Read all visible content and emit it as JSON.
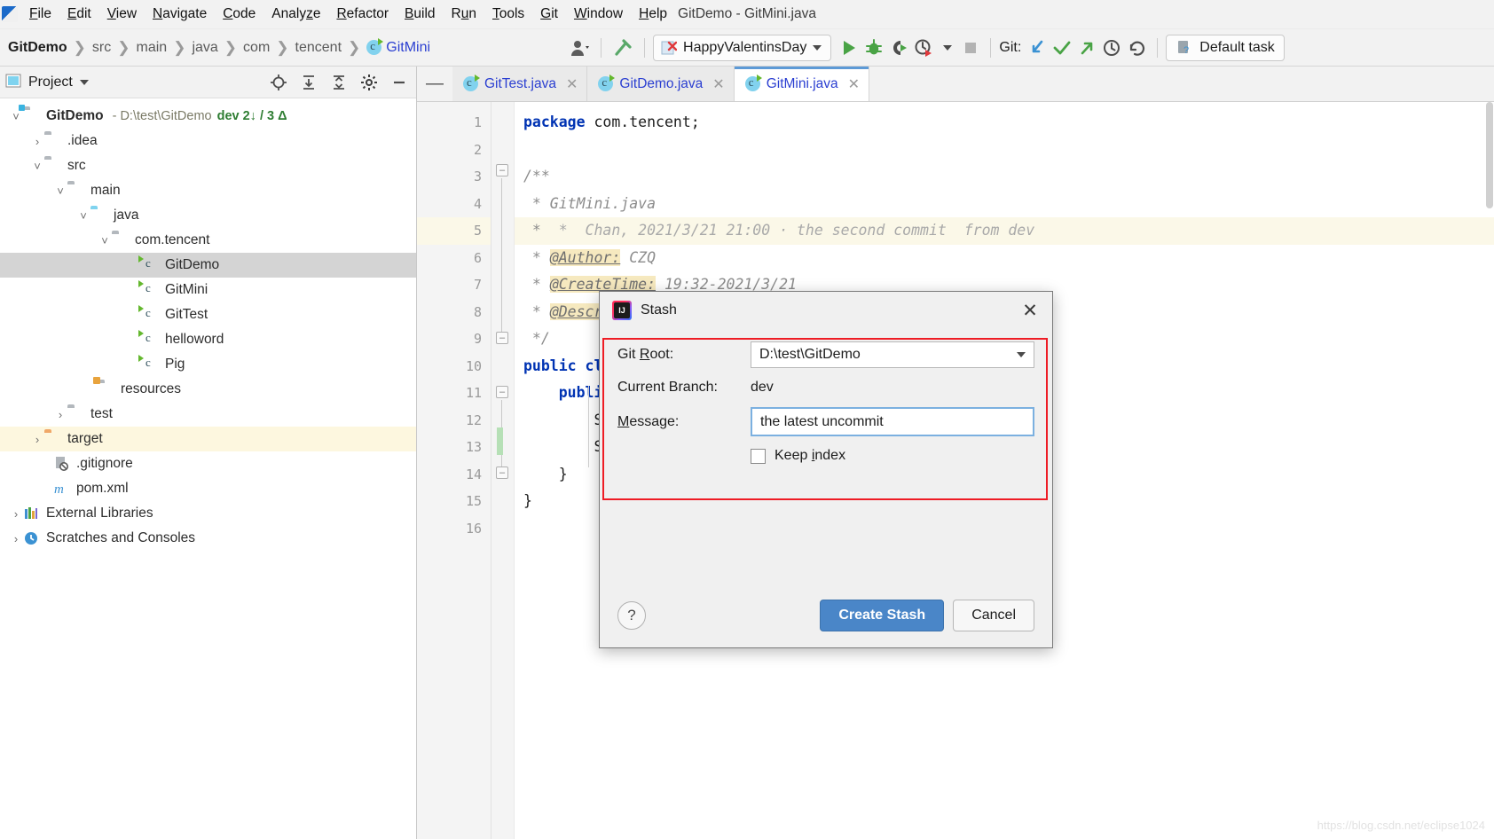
{
  "window": {
    "title": "GitDemo - GitMini.java"
  },
  "menubar": {
    "items": [
      {
        "label": "File",
        "mnemonic": "F"
      },
      {
        "label": "Edit",
        "mnemonic": "E"
      },
      {
        "label": "View",
        "mnemonic": "V"
      },
      {
        "label": "Navigate",
        "mnemonic": "N"
      },
      {
        "label": "Code",
        "mnemonic": "C"
      },
      {
        "label": "Analyze",
        "mnemonic": "z"
      },
      {
        "label": "Refactor",
        "mnemonic": "R"
      },
      {
        "label": "Build",
        "mnemonic": "B"
      },
      {
        "label": "Run",
        "mnemonic": "u"
      },
      {
        "label": "Tools",
        "mnemonic": "T"
      },
      {
        "label": "Git",
        "mnemonic": "G"
      },
      {
        "label": "Window",
        "mnemonic": "W"
      },
      {
        "label": "Help",
        "mnemonic": "H"
      }
    ]
  },
  "toolbar": {
    "breadcrumbs": [
      "GitDemo",
      "src",
      "main",
      "java",
      "com",
      "tencent",
      "GitMini"
    ],
    "run_config": "HappyValentinsDay",
    "git_label": "Git:",
    "default_task": "Default task",
    "icons": {
      "avatar": "user-icon",
      "build": "hammer-icon",
      "run": "run-icon",
      "debug": "debug-icon",
      "run_coverage": "run-with-coverage-icon",
      "profile": "profiler-icon",
      "stop": "stop-icon",
      "update": "git-update-icon",
      "commit": "git-commit-icon",
      "push": "git-push-icon",
      "history": "history-icon",
      "rollback": "rollback-icon",
      "task": "task-icon"
    }
  },
  "project_panel": {
    "title": "Project",
    "icons": [
      "locate-icon",
      "expand-all-icon",
      "collapse-all-icon",
      "settings-gear-icon",
      "hide-icon"
    ],
    "tree": [
      {
        "label": "GitDemo",
        "meta_path": "- D:\\test\\GitDemo",
        "meta_branch": "dev 2↓ / 3 Δ",
        "depth": 0,
        "arrow": "down",
        "icon": "module-folder",
        "color": "blue-bold",
        "state": "normal"
      },
      {
        "label": ".idea",
        "depth": 1,
        "arrow": "right",
        "icon": "folder",
        "color": "gray",
        "state": "normal"
      },
      {
        "label": "src",
        "depth": 1,
        "arrow": "down",
        "icon": "folder",
        "color": "gray",
        "state": "normal"
      },
      {
        "label": "main",
        "depth": 2,
        "arrow": "down",
        "icon": "folder",
        "color": "gray",
        "state": "normal"
      },
      {
        "label": "java",
        "depth": 3,
        "arrow": "down",
        "icon": "source-folder",
        "color": "gray",
        "state": "normal"
      },
      {
        "label": "com.tencent",
        "depth": 4,
        "arrow": "down",
        "icon": "package",
        "color": "blue",
        "state": "normal"
      },
      {
        "label": "GitDemo",
        "depth": 5,
        "arrow": "none",
        "icon": "java-class",
        "color": "blue",
        "state": "selected"
      },
      {
        "label": "GitMini",
        "depth": 5,
        "arrow": "none",
        "icon": "java-class",
        "color": "blue",
        "state": "normal"
      },
      {
        "label": "GitTest",
        "depth": 5,
        "arrow": "none",
        "icon": "java-class",
        "color": "blue",
        "state": "normal"
      },
      {
        "label": "helloword",
        "depth": 5,
        "arrow": "none",
        "icon": "java-class",
        "color": "black",
        "state": "normal"
      },
      {
        "label": "Pig",
        "depth": 5,
        "arrow": "none",
        "icon": "java-class",
        "color": "orange",
        "state": "normal"
      },
      {
        "label": "resources",
        "depth": 4,
        "arrow": "none",
        "icon": "resource-folder",
        "color": "gray",
        "state": "normal"
      },
      {
        "label": "test",
        "depth": 3,
        "arrow": "right",
        "icon": "folder",
        "color": "gray",
        "state": "normal"
      },
      {
        "label": "target",
        "depth": 1,
        "arrow": "right",
        "icon": "excluded-folder",
        "color": "black",
        "state": "highlighted"
      },
      {
        "label": ".gitignore",
        "depth": 2,
        "arrow": "none",
        "icon": "gitignore-file",
        "color": "black",
        "state": "normal"
      },
      {
        "label": "pom.xml",
        "depth": 2,
        "arrow": "none",
        "icon": "maven-file",
        "color": "black",
        "state": "normal"
      },
      {
        "label": "External Libraries",
        "depth": 0,
        "arrow": "right",
        "icon": "libraries-icon",
        "color": "black",
        "state": "normal"
      },
      {
        "label": "Scratches and Consoles",
        "depth": 0,
        "arrow": "right",
        "icon": "scratches-icon",
        "color": "black",
        "state": "normal"
      }
    ]
  },
  "editor": {
    "tabs": [
      {
        "label": "GitTest.java",
        "active": false
      },
      {
        "label": "GitDemo.java",
        "active": false
      },
      {
        "label": "GitMini.java",
        "active": true
      }
    ],
    "line_numbers": [
      "1",
      "2",
      "3",
      "4",
      "5",
      "6",
      "7",
      "8",
      "9",
      "10",
      "11",
      "12",
      "13",
      "14",
      "15",
      "16"
    ],
    "lines": [
      {
        "n": "1",
        "text": "package com.tencent;"
      },
      {
        "n": "2",
        "text": ""
      },
      {
        "n": "3",
        "text": "/**"
      },
      {
        "n": "4",
        "text": " * GitMini.java"
      },
      {
        "n": "5",
        "text": " *  Chan, 2021/3/21 21:00 · the second commit  from dev"
      },
      {
        "n": "6",
        "text": " * @Author: CZQ"
      },
      {
        "n": "7",
        "text": " * @CreateTime: 19:32-2021/3/21"
      },
      {
        "n": "8",
        "text": " * @Description:"
      },
      {
        "n": "9",
        "text": " */"
      },
      {
        "n": "10",
        "text": "public class"
      },
      {
        "n": "11",
        "text": "    public"
      },
      {
        "n": "12",
        "text": "        Sy"
      },
      {
        "n": "13",
        "text": "        Sy"
      },
      {
        "n": "14",
        "text": "    }"
      },
      {
        "n": "15",
        "text": "}"
      },
      {
        "n": "16",
        "text": ""
      }
    ],
    "blame_line": " *  Chan, 2021/3/21 21:00 · the second commit  from dev",
    "tag_author": "@Author:",
    "tag_author_value": " CZQ",
    "tag_createtime": "@CreateTime:",
    "tag_createtime_value": " 19:32-2021/3/21",
    "tag_description": "@Descri"
  },
  "dialog": {
    "title": "Stash",
    "close_label": "✕",
    "git_root_label": "Git Root:",
    "git_root_mnemonic": "R",
    "git_root_value": "D:\\test\\GitDemo",
    "current_branch_label": "Current Branch:",
    "current_branch_value": "dev",
    "message_label": "Message:",
    "message_mnemonic": "M",
    "message_value": "the latest uncommit",
    "keep_index_label": "Keep index",
    "keep_index_mnemonic": "i",
    "keep_index_checked": false,
    "help_label": "?",
    "create_label": "Create Stash",
    "cancel_label": "Cancel",
    "highlight_color": "#ee1c25",
    "primary_color": "#4a86c8"
  },
  "watermark": "https://blog.csdn.net/eclipse1024"
}
